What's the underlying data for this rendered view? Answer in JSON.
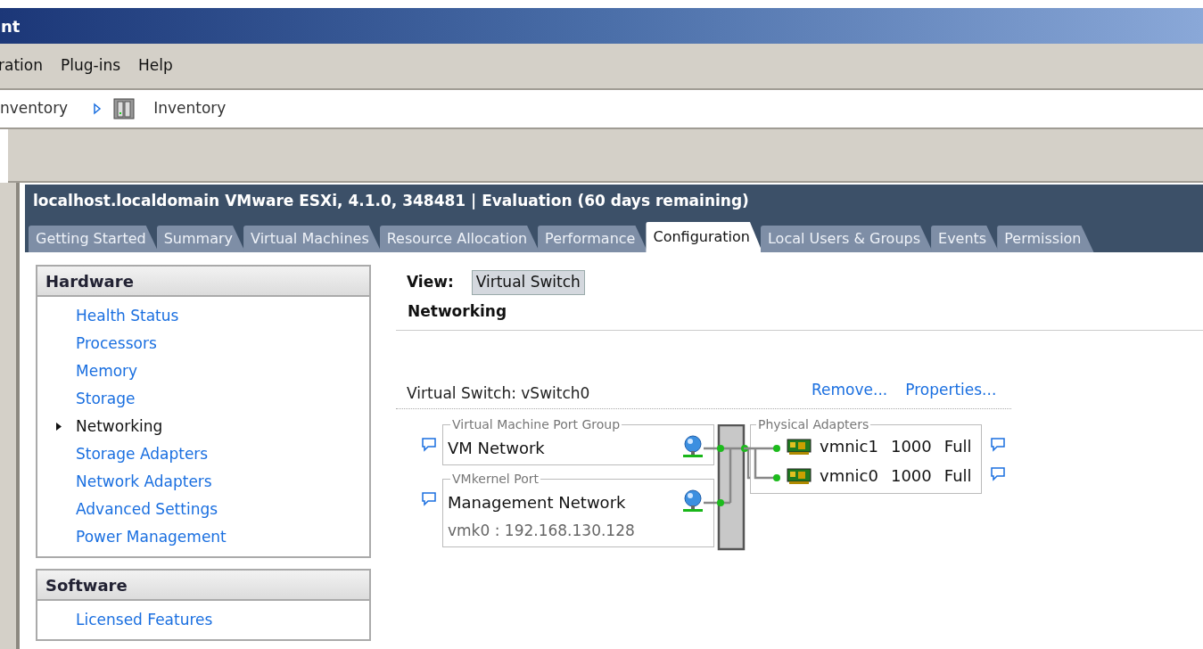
{
  "title_bar": {
    "title": "nt"
  },
  "menu": [
    "ration",
    "Plug-ins",
    "Help"
  ],
  "breadcrumb": [
    {
      "label": "nventory",
      "icon": false
    },
    {
      "label": "Inventory",
      "icon": true
    }
  ],
  "host_header": "localhost.localdomain VMware ESXi, 4.1.0, 348481 | Evaluation (60 days remaining)",
  "tabs": [
    {
      "label": "Getting Started",
      "selected": false
    },
    {
      "label": "Summary",
      "selected": false
    },
    {
      "label": "Virtual Machines",
      "selected": false
    },
    {
      "label": "Resource Allocation",
      "selected": false
    },
    {
      "label": "Performance",
      "selected": false
    },
    {
      "label": "Configuration",
      "selected": true
    },
    {
      "label": "Local Users & Groups",
      "selected": false
    },
    {
      "label": "Events",
      "selected": false
    },
    {
      "label": "Permission",
      "selected": false
    }
  ],
  "sections": [
    {
      "title": "Hardware",
      "items": [
        {
          "label": "Health Status",
          "selected": false
        },
        {
          "label": "Processors",
          "selected": false
        },
        {
          "label": "Memory",
          "selected": false
        },
        {
          "label": "Storage",
          "selected": false
        },
        {
          "label": "Networking",
          "selected": true
        },
        {
          "label": "Storage Adapters",
          "selected": false
        },
        {
          "label": "Network Adapters",
          "selected": false
        },
        {
          "label": "Advanced Settings",
          "selected": false
        },
        {
          "label": "Power Management",
          "selected": false
        }
      ]
    },
    {
      "title": "Software",
      "items": [
        {
          "label": "Licensed Features",
          "selected": false
        }
      ]
    }
  ],
  "view": {
    "label": "View:",
    "value": "Virtual Switch"
  },
  "heading": "Networking",
  "vswitch": {
    "title": "Virtual Switch: vSwitch0",
    "actions": [
      "Remove...",
      "Properties..."
    ],
    "port_groups": [
      {
        "group_label": "Virtual Machine Port Group",
        "name": "VM Network"
      },
      {
        "group_label": "VMkernel Port",
        "name": "Management Network",
        "detail": "vmk0 : 192.168.130.128"
      }
    ],
    "adapters": {
      "label": "Physical Adapters",
      "items": [
        {
          "name": "vmnic1",
          "speed": "1000",
          "duplex": "Full"
        },
        {
          "name": "vmnic0",
          "speed": "1000",
          "duplex": "Full"
        }
      ]
    }
  }
}
